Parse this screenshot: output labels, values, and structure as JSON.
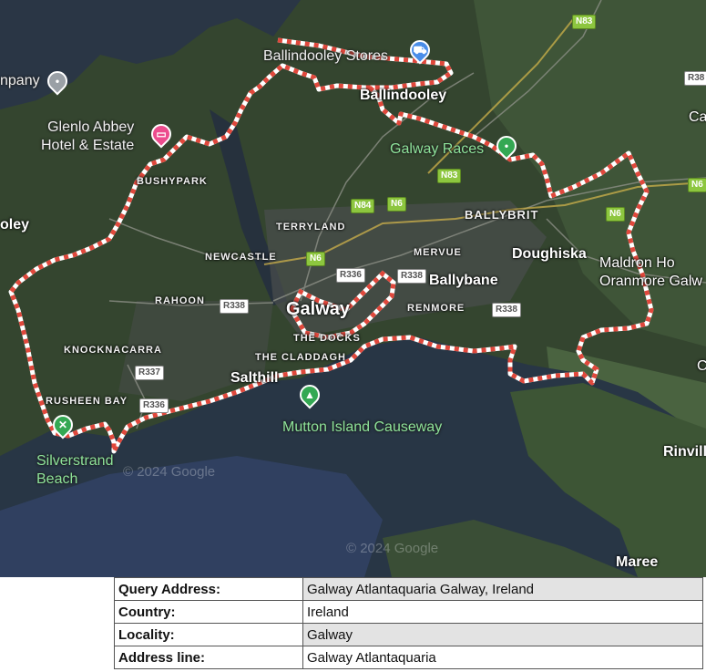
{
  "map": {
    "places": {
      "galway": "Galway",
      "doughiska": "Doughiska",
      "ballybane": "Ballybane",
      "ballindooley": "Ballindooley",
      "salthill": "Salthill",
      "maree": "Maree",
      "rinville": "Rinvill",
      "oranmore": "Maldron Ho\nOranmore Galw",
      "left_edge": "oley",
      "right_edge_ca": "Ca",
      "right_edge_c": "C"
    },
    "areas": {
      "bushypark": "BUSHYPARK",
      "terryland": "TERRYLAND",
      "newcastle": "NEWCASTLE",
      "mervue": "MERVUE",
      "ballybrit": "BALLYBRIT",
      "rahoon": "RAHOON",
      "renmore": "RENMORE",
      "the_docks": "THE DOCKS",
      "the_claddagh": "THE CLADDAGH",
      "knocknacarra": "KNOCKNACARRA",
      "rusheen_bay": "RUSHEEN BAY"
    },
    "pois": {
      "ballindooley_stores": "Ballindooley Stores",
      "company": "npany",
      "glenlo": "Glenlo Abbey\nHotel & Estate",
      "galway_races": "Galway Races",
      "mutton_island": "Mutton Island Causeway",
      "silverstrand": "Silverstrand\nBeach"
    },
    "roads": {
      "n83_top": "N83",
      "n83_mid": "N83",
      "n84": "N84",
      "n6_a": "N6",
      "n6_b": "N6",
      "n6_c": "N6",
      "n6_right": "N6",
      "r338_a": "R338",
      "r338_b": "R338",
      "r338_c": "R338",
      "r336_a": "R336",
      "r336_b": "R336",
      "r337": "R337",
      "r38_edge": "R38"
    },
    "watermark": "© 2024 Google",
    "colors": {
      "boundary": "#e0483c",
      "water": "#2b3a4e",
      "land": "#3a4a36",
      "city_pin": "#ec4c8d",
      "shop_pin": "#4a8de8",
      "park_pin": "#34a853",
      "info_pin": "#9aa0a6"
    }
  },
  "info_table": [
    {
      "key": "Query Address:",
      "value": "Galway Atlantaquaria  Galway, Ireland"
    },
    {
      "key": "Country:",
      "value": "Ireland"
    },
    {
      "key": "Locality:",
      "value": "Galway"
    },
    {
      "key": "Address line:",
      "value": "Galway Atlantaquaria"
    }
  ]
}
